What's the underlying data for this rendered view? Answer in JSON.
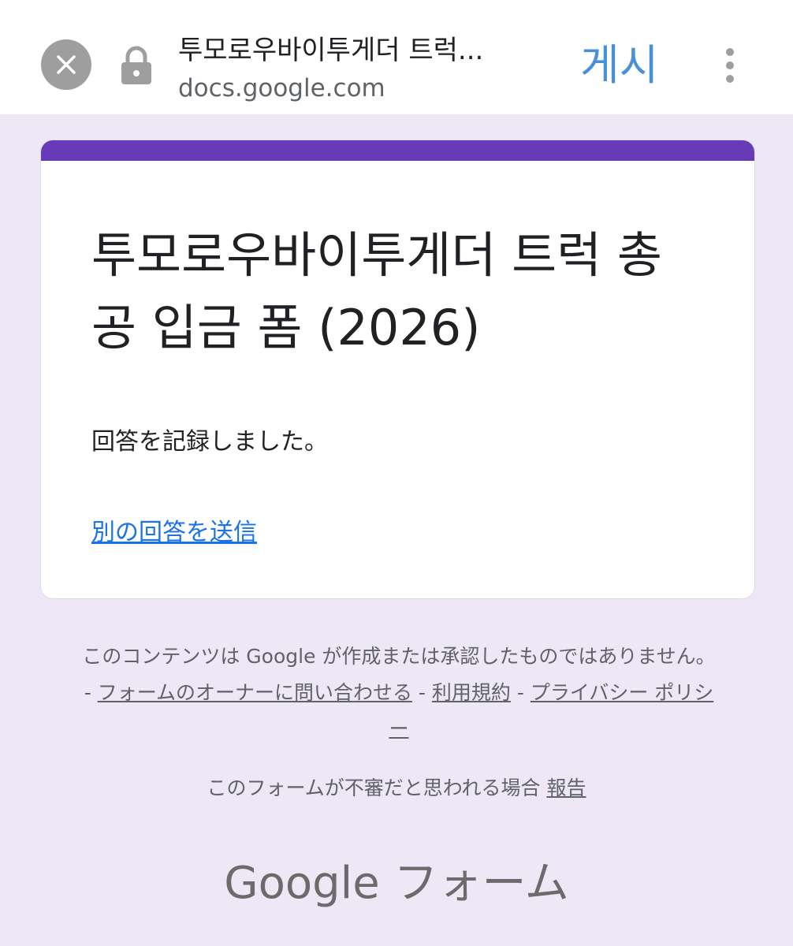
{
  "browser": {
    "title": "투모로우바이투게더 트럭...",
    "url": "docs.google.com",
    "share_label": "게시"
  },
  "form": {
    "title": "투모로우바이투게더 트럭 총공 입금 폼 (2026)",
    "confirmation": "回答を記録しました。",
    "resubmit_link": "別の回答を送信"
  },
  "footer": {
    "disclaimer": "このコンテンツは Google が作成または承認したものではありません。",
    "sep": "-",
    "contact_owner": "フォームのオーナーに問い合わせる",
    "terms": "利用規約",
    "privacy": "プライバシー ポリシー",
    "report_prefix": "このフォームが不審だと思われる場合",
    "report_link": "報告",
    "brand_google": "Google",
    "brand_forms": "フォーム"
  },
  "icons": {
    "close": "close-icon",
    "lock": "lock-icon",
    "more": "more-vert-icon"
  },
  "colors": {
    "accent": "#673ab7",
    "background": "#ede7f6",
    "link": "#1a73e8"
  }
}
